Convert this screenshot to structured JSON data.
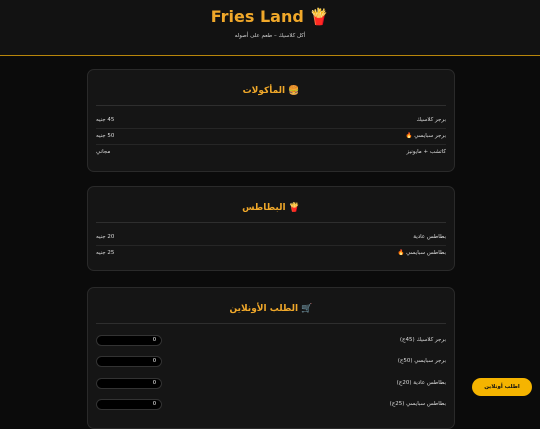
{
  "header": {
    "title": "Fries Land 🍟",
    "subtitle": "أكل كلاسيك – طعم على أصوله"
  },
  "menu": {
    "title": "🍔 المأكولات",
    "items": [
      {
        "name": "برجر كلاسيك",
        "price": "45 جنيه"
      },
      {
        "name": "برجر سبايسي 🔥",
        "price": "50 جنيه"
      },
      {
        "name": "كاتشب + مايونيز",
        "price": "مجاني"
      }
    ]
  },
  "fries": {
    "title": "🍟 البطاطس",
    "items": [
      {
        "name": "بطاطس عادية",
        "price": "20 جنيه"
      },
      {
        "name": "بطاطس سبايسي 🔥",
        "price": "25 جنيه"
      }
    ]
  },
  "order": {
    "title": "🛒 الطلب الأونلاين",
    "items": [
      {
        "label": "برجر كلاسيك (45ج)",
        "qty": "0"
      },
      {
        "label": "برجر سبايسي (50ج)",
        "qty": "0"
      },
      {
        "label": "بطاطس عادية (20ج)",
        "qty": "0"
      },
      {
        "label": "بطاطس سبايسي (25ج)",
        "qty": "0"
      }
    ]
  },
  "order_button": "اطلب أونلاين",
  "colors": {
    "accent": "#f0a82a",
    "button": "#f5b400",
    "background": "#0b0b0b"
  }
}
